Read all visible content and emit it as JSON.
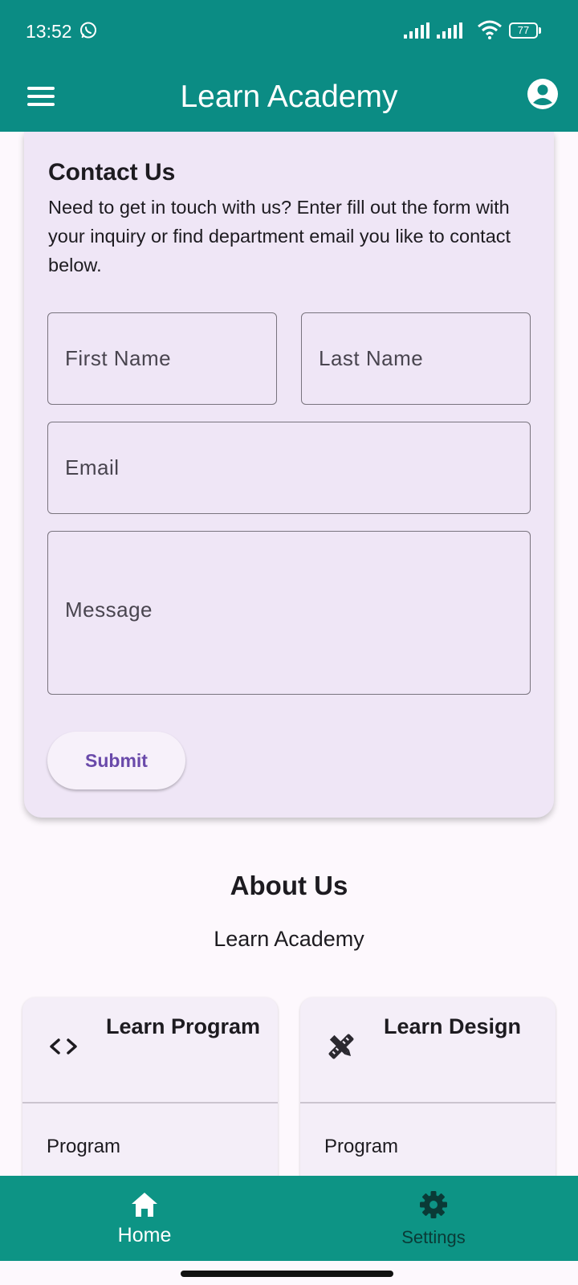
{
  "status_bar": {
    "time": "13:52",
    "battery": "77",
    "icons": [
      "whatsapp-icon",
      "signal-icon",
      "signal-icon",
      "wifi-icon",
      "battery-icon"
    ]
  },
  "app_bar": {
    "title": "Learn Academy",
    "icons": [
      "menu-icon",
      "account-icon"
    ]
  },
  "contact": {
    "title": "Contact Us",
    "description": "Need to get in touch with us? Enter fill out the form with your inquiry or find department email you like to contact below.",
    "fields": {
      "first_name": {
        "placeholder": "First Name",
        "value": ""
      },
      "last_name": {
        "placeholder": "Last Name",
        "value": ""
      },
      "email": {
        "placeholder": "Email",
        "value": ""
      },
      "message": {
        "placeholder": "Message",
        "value": ""
      }
    },
    "submit_label": "Submit"
  },
  "about": {
    "title": "About Us",
    "subtitle": "Learn Academy"
  },
  "courses": [
    {
      "title": "Learn Program",
      "icon": "code-icon",
      "line": "Program"
    },
    {
      "title": "Learn Design",
      "icon": "design-tools-icon",
      "line": "Program"
    }
  ],
  "bottom_nav": {
    "items": [
      {
        "label": "Home",
        "icon": "home-icon",
        "selected": true
      },
      {
        "label": "Settings",
        "icon": "gear-icon",
        "selected": false
      }
    ]
  },
  "colors": {
    "primary": "#0b8c84",
    "nav_background": "#0d9485",
    "card_background": "#efe6f6",
    "button_text": "#6a4aaa"
  }
}
